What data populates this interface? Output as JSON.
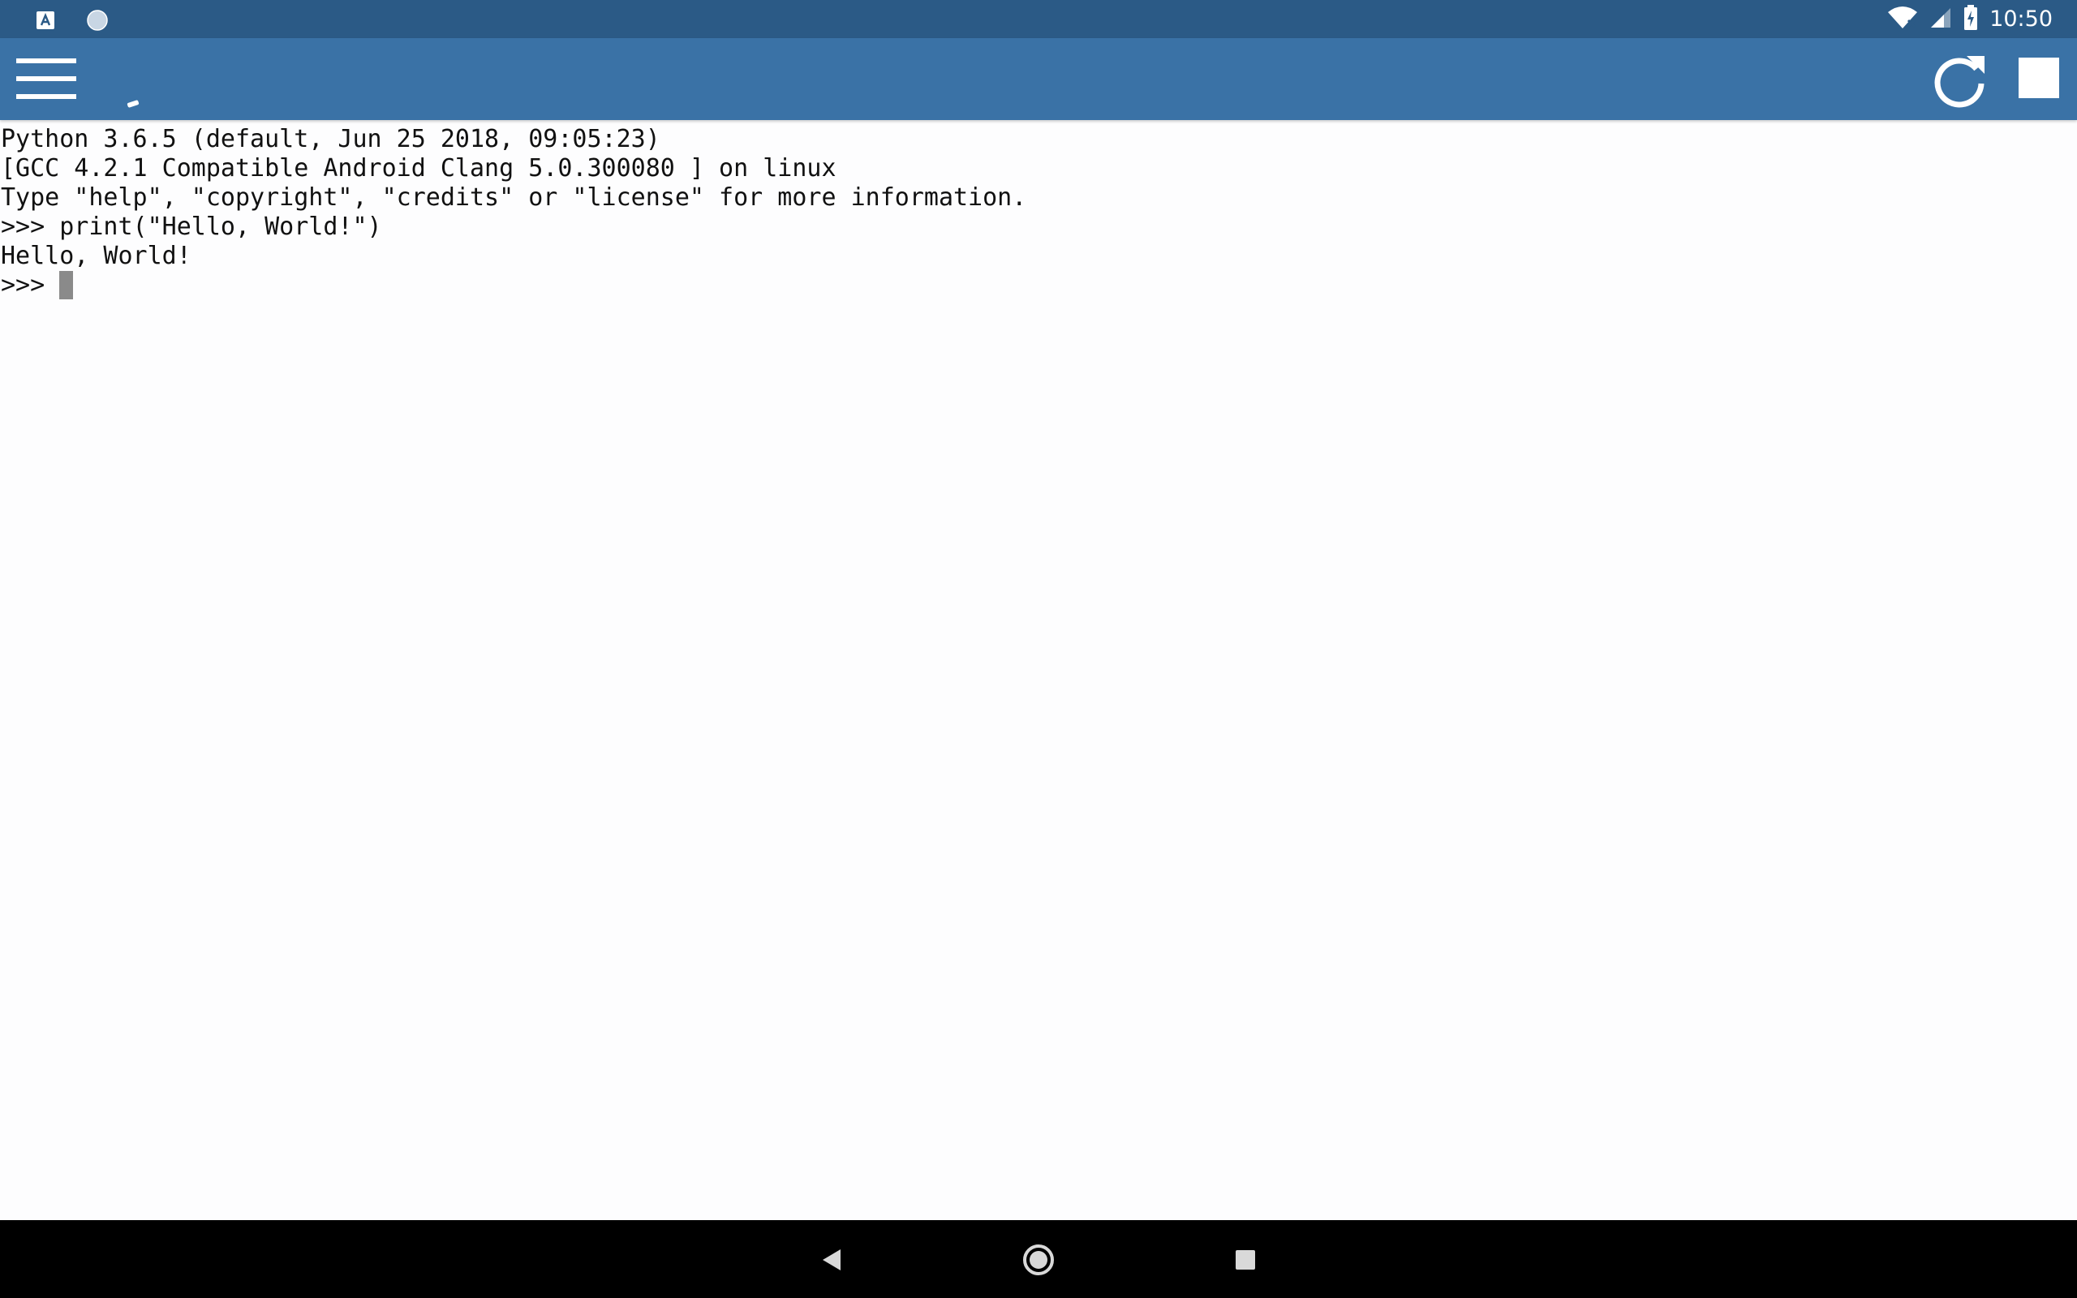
{
  "status_bar": {
    "time": "10:50",
    "notification_icons": [
      "keyboard-a-icon",
      "circle-app-icon"
    ],
    "system_icons": [
      "wifi-no-internet-icon",
      "cell-signal-icon",
      "battery-charging-icon"
    ]
  },
  "toolbar": {
    "menu_icon": "hamburger-menu-icon",
    "actions": [
      "refresh-icon",
      "stop-icon"
    ]
  },
  "console": {
    "lines": [
      "Python 3.6.5 (default, Jun 25 2018, 09:05:23)",
      "[GCC 4.2.1 Compatible Android Clang 5.0.300080 ] on linux",
      "Type \"help\", \"copyright\", \"credits\" or \"license\" for more information.",
      ">>> print(\"Hello, World!\")",
      "Hello, World!"
    ],
    "prompt": ">>>"
  },
  "nav_bar": {
    "buttons": [
      "back-icon",
      "home-icon",
      "recents-icon"
    ]
  },
  "colors": {
    "status_bar": "#2b5a86",
    "toolbar": "#3a72a6",
    "console_bg": "#fdfdfe",
    "cursor": "#8a8a8a"
  }
}
